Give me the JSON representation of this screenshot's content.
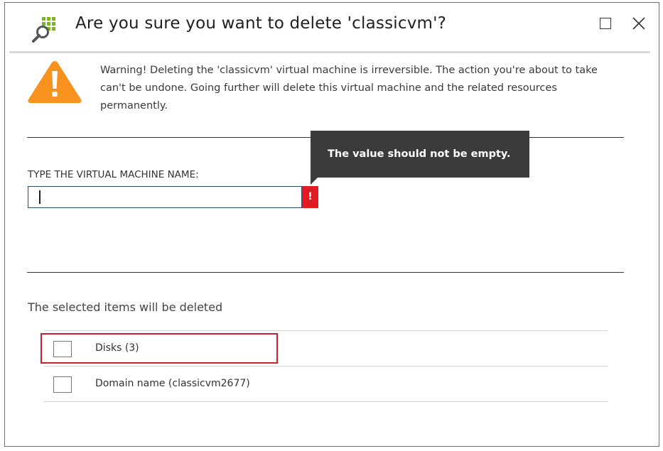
{
  "dialog": {
    "title": "Are you sure you want to delete 'classicvm'?",
    "icon": "vm-search-icon",
    "maximize_icon": "maximize-icon",
    "close_icon": "close-icon",
    "close_glyph": "✕"
  },
  "warning": {
    "icon": "warning-triangle-icon",
    "color": "#f7921e",
    "text": "Warning! Deleting the 'classicvm' virtual machine is irreversible. The action you're about to take can't be undone. Going further will delete this virtual machine and the related resources permanently."
  },
  "name_field": {
    "label": "TYPE THE VIRTUAL MACHINE NAME:",
    "value": "",
    "error_glyph": "!",
    "error_color": "#e01b24",
    "tooltip": "The value should not be empty."
  },
  "items": {
    "heading": "The selected items will be deleted",
    "rows": [
      {
        "label": "Disks (3)",
        "checked": false
      },
      {
        "label": "Domain name (classicvm2677)",
        "checked": false
      }
    ],
    "highlight_color": "#d0202a"
  }
}
